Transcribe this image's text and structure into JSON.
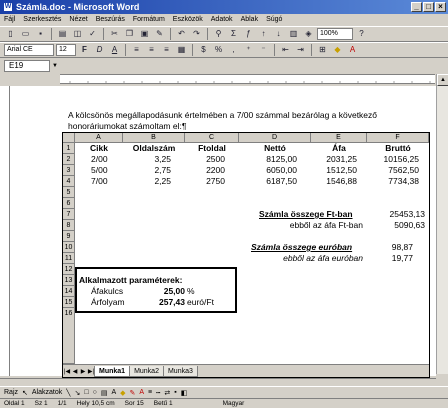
{
  "window": {
    "title": "Számla.doc - Microsoft Word",
    "app_icon": "W"
  },
  "menu": [
    "Fájl",
    "Szerkesztés",
    "Nézet",
    "Beszúrás",
    "Formátum",
    "Eszközök",
    "Adatok",
    "Ablak",
    "Súgó"
  ],
  "toolbar2": {
    "font": "Arial CE",
    "size": "12",
    "zoom": "100%"
  },
  "namebox": "E19",
  "document": {
    "paragraph": "A kölcsönös megállapodásunk értelmében a 7/00 számmal bezárólag a következő honoráriumokat számoltam el:¶"
  },
  "sheet": {
    "columns": [
      "A",
      "B",
      "C",
      "D",
      "E",
      "F"
    ],
    "rows": [
      "1",
      "2",
      "3",
      "4",
      "5",
      "6",
      "7",
      "8",
      "9",
      "10",
      "11",
      "12",
      "13",
      "14",
      "15",
      "16"
    ],
    "headers": [
      "Cikk",
      "Oldalszám",
      "Ftoldal",
      "Nettó",
      "Áfa",
      "Bruttó"
    ],
    "data": [
      [
        "2/00",
        "3,25",
        "2500",
        "8125,00",
        "2031,25",
        "10156,25"
      ],
      [
        "5/00",
        "2,75",
        "2200",
        "6050,00",
        "1512,50",
        "7562,50"
      ],
      [
        "7/00",
        "2,25",
        "2750",
        "6187,50",
        "1546,88",
        "7734,38"
      ]
    ],
    "sum_ft_label": "Számla összege Ft-ban",
    "sum_ft_value": "25453,13",
    "vat_ft_label": "ebből az áfa Ft-ban",
    "vat_ft_value": "5090,63",
    "sum_eur_label": "Számla összege euróban",
    "sum_eur_value": "98,87",
    "vat_eur_label": "ebből az áfa euróban",
    "vat_eur_value": "19,77",
    "params_title": "Alkalmazott paraméterek:",
    "vat_rate_label": "Áfakulcs",
    "vat_rate_value": "25,00",
    "vat_rate_unit": "%",
    "rate_label": "Árfolyam",
    "rate_value": "257,43",
    "rate_unit": "euró/Ft",
    "tabs": [
      "Munka1",
      "Munka2",
      "Munka3"
    ]
  },
  "drawbar": {
    "draw": "Rajz",
    "autoshapes": "Alakzatok"
  },
  "status": [
    "Oldal 1",
    "Sz 1",
    "1/1",
    "Hely 10,5 cm",
    "Sor 15",
    "Betű 1",
    "Magyar"
  ]
}
